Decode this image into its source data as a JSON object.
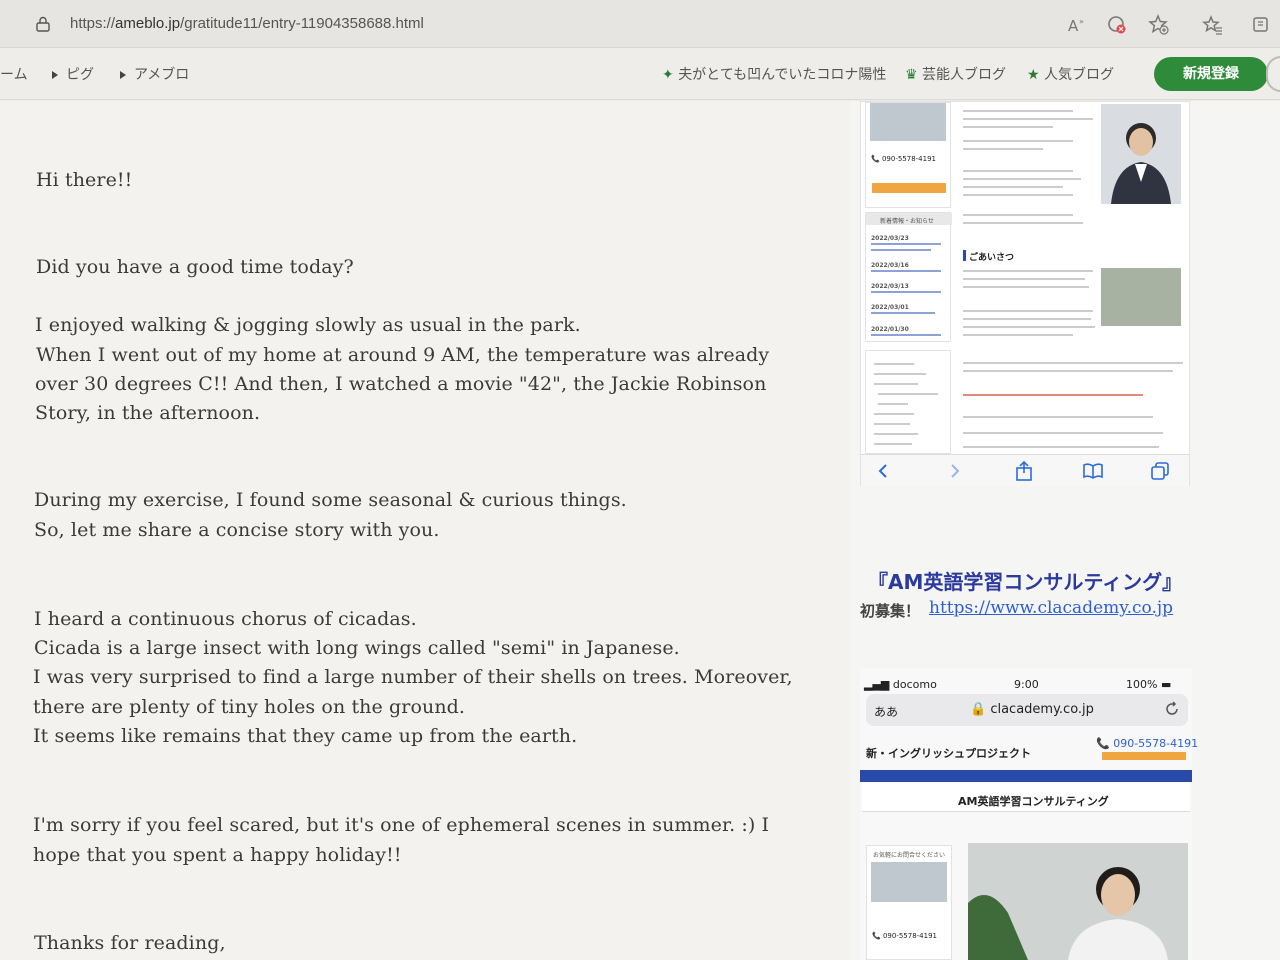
{
  "browser": {
    "url_prefix": "https://",
    "url_host": "ameblo.jp",
    "url_path": "/gratitude11/entry-11904358688.html",
    "icons": [
      "lock-icon",
      "read-aloud-icon",
      "tracking-icon",
      "favorite-add-icon",
      "favorites-icon",
      "collections-icon"
    ]
  },
  "sitenav": {
    "home": "ーム",
    "pigg": "ピグ",
    "ameblo": "アメブロ",
    "story_link": "夫がとても凹んでいたコロナ陽性",
    "celebrity_blog": "芸能人ブログ",
    "popular_blog": "人気ブログ",
    "register": "新規登録"
  },
  "article": {
    "greeting": "Hi there!!",
    "question": "Did you have a good time today?",
    "para1": [
      "I enjoyed walking & jogging slowly as usual in the park.",
      "When I went out of my home at around 9 AM, the temperature was already",
      "over 30 degrees C!! And then, I watched a movie \"42\", the Jackie Robinson",
      "Story, in the afternoon."
    ],
    "para2": [
      "During my exercise, I found some seasonal & curious things.",
      "So, let me share a concise story with you."
    ],
    "para3": [
      "I heard a continuous chorus of cicadas.",
      "Cicada is a large insect with long wings called \"semi\" in Japanese.",
      "I was very surprised to find a large number of their shells on trees. Moreover,",
      "there are plenty of tiny holes on the ground.",
      "It seems like remains that they came up from the earth."
    ],
    "para4": [
      "I'm sorry if you feel scared, but it's one of ephemeral scenes in summer. :) I",
      "hope that you spent a happy holiday!!"
    ],
    "closing": "Thanks for reading,"
  },
  "sidebar": {
    "phone_number": "090-5578-4191",
    "news_header": "新着情報・お知らせ",
    "news_dates": [
      "2022/03/23",
      "2022/03/16",
      "2022/03/13",
      "2022/03/01",
      "2022/01/30"
    ],
    "greeting_heading": "ごあいさつ",
    "am_title": "『AM英語学習コンサルティング』",
    "recruit_label": "初募集！",
    "recruit_url": "https://www.clacademy.co.jp",
    "phone_carrier": "docomo",
    "phone_time": "9:00",
    "phone_battery": "100%",
    "phone_aa": "ああ",
    "phone_site": "clacademy.co.jp",
    "phone_project": "新・イングリッシュプロジェクト",
    "phone_phone": "090-5578-4191",
    "phone_banner": "AM英語学習コンサルティング",
    "phone_contact": "お気軽にお問合せください"
  }
}
